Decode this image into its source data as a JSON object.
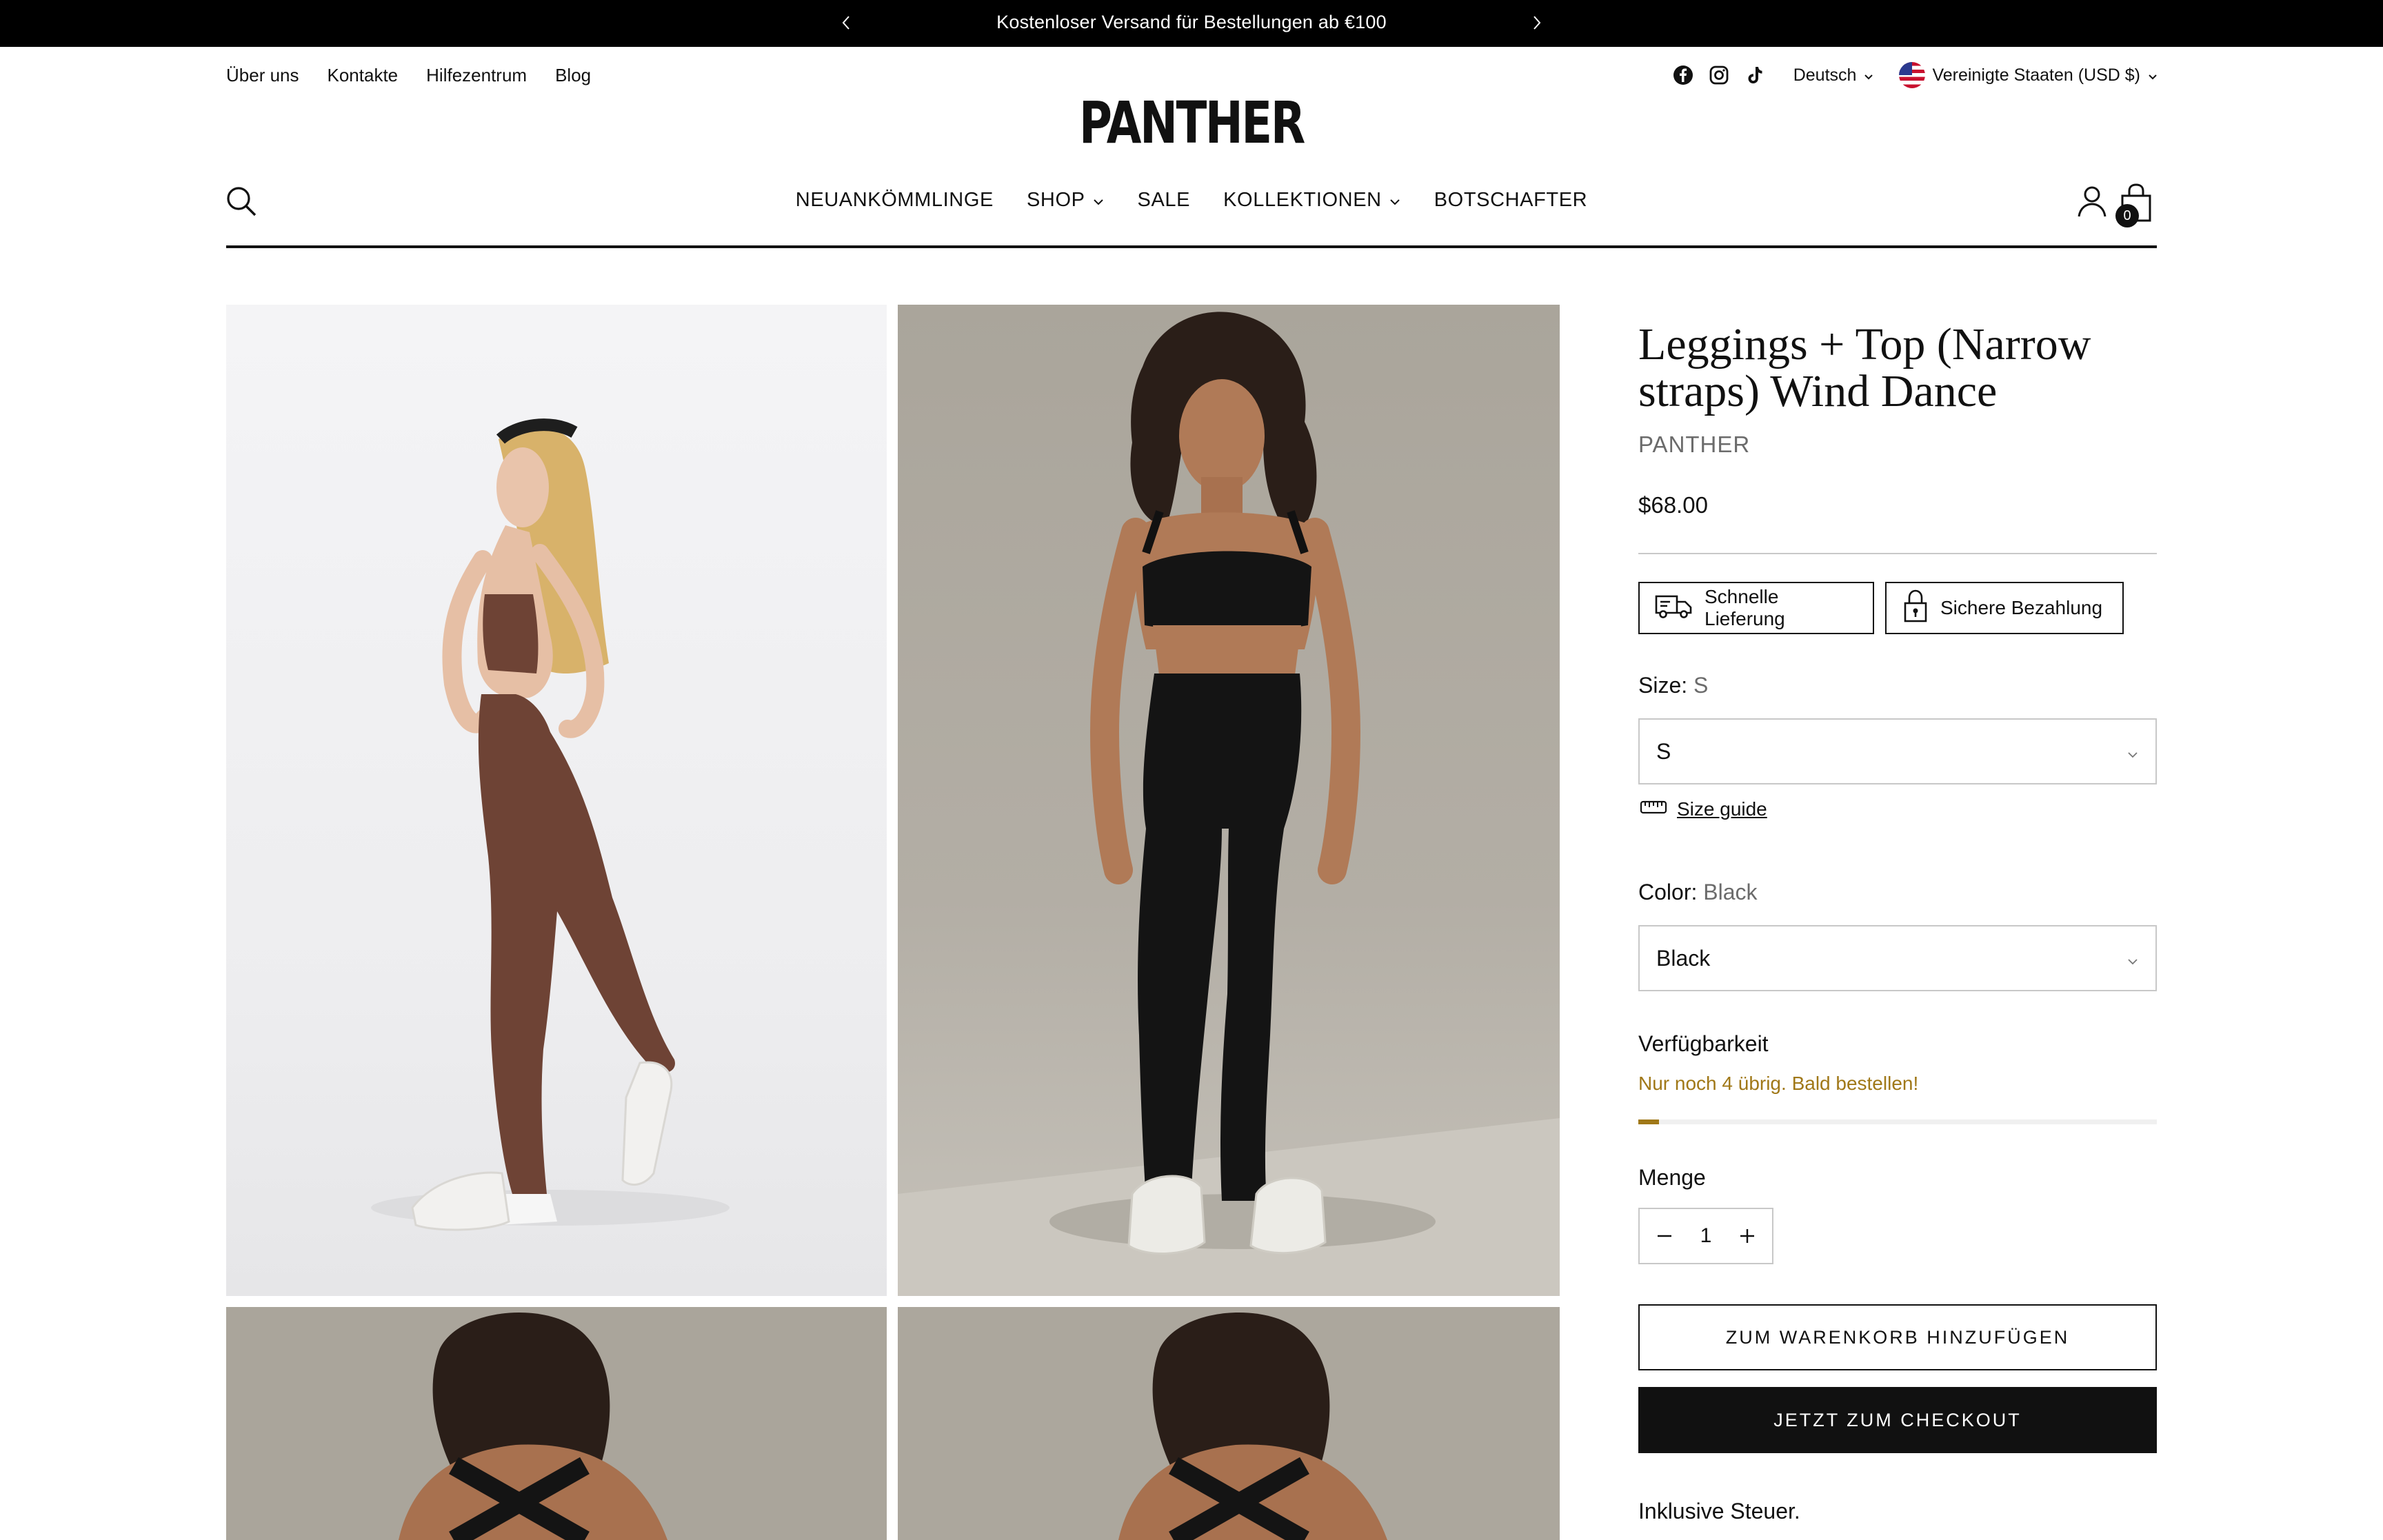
{
  "announcement": {
    "text": "Kostenloser Versand für Bestellungen ab €100"
  },
  "utility_links": [
    "Über uns",
    "Kontakte",
    "Hilfezentrum",
    "Blog"
  ],
  "social_icons": [
    "facebook-icon",
    "instagram-icon",
    "tiktok-icon"
  ],
  "language": "Deutsch",
  "country": "Vereinigte Staaten (USD $)",
  "brand": {
    "logo": "PANTHER"
  },
  "nav": {
    "items": [
      {
        "label": "NEUANKÖMMLINGE",
        "has_dropdown": false
      },
      {
        "label": "SHOP",
        "has_dropdown": true
      },
      {
        "label": "SALE",
        "has_dropdown": false
      },
      {
        "label": "KOLLEKTIONEN",
        "has_dropdown": true
      },
      {
        "label": "BOTSCHAFTER",
        "has_dropdown": false
      }
    ]
  },
  "cart": {
    "count": "0"
  },
  "product": {
    "title": "Leggings + Top (Narrow straps) Wind Dance",
    "vendor": "PANTHER",
    "price": "$68.00",
    "badges": [
      {
        "label": "Schnelle Lieferung",
        "icon": "delivery-truck-icon"
      },
      {
        "label": "Sichere Bezahlung",
        "icon": "padlock-icon"
      }
    ],
    "size": {
      "label": "Size:",
      "value": "S",
      "selected": "S"
    },
    "size_guide": "Size guide",
    "color": {
      "label": "Color:",
      "value": "Black",
      "selected": "Black"
    },
    "availability": {
      "label": "Verfügbarkeit",
      "message": "Nur noch 4 übrig. Bald bestellen!",
      "stock_fraction": 0.04
    },
    "quantity": {
      "label": "Menge",
      "value": "1"
    },
    "add_to_cart": "ZUM WARENKORB HINZUFÜGEN",
    "checkout": "JETZT ZUM CHECKOUT",
    "tax_note": "Inklusive Steuer."
  },
  "colors": {
    "announcement_bg": "#000000",
    "accent_warning": "#a07818",
    "button_dark": "#111111",
    "border": "#c8c8c8"
  }
}
